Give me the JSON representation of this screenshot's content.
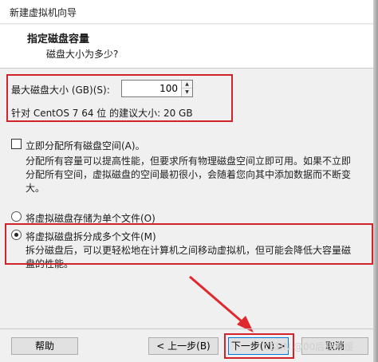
{
  "window": {
    "title": "新建虚拟机向导"
  },
  "header": {
    "title": "指定磁盘容量",
    "subtitle": "磁盘大小为多少?"
  },
  "disk": {
    "max_size_label": "最大磁盘大小 (GB)(S):",
    "max_size_value": "100",
    "recommend_text": "针对 CentOS 7 64 位 的建议大小: 20 GB"
  },
  "allocate": {
    "checkbox_label": "立即分配所有磁盘空间(A)。",
    "checked": false,
    "desc_line1": "分配所有容量可以提高性能，但要求所有物理磁盘空间立即可用。如果不立即",
    "desc_line2": "分配所有空间，虚拟磁盘的空间最初很小，会随着您向其中添加数据而不断变",
    "desc_line3": "大。"
  },
  "storage": {
    "single_label": "将虚拟磁盘存储为单个文件(O)",
    "split_label": "将虚拟磁盘拆分成多个文件(M)",
    "split_desc_line1": "拆分磁盘后，可以更轻松地在计算机之间移动虚拟机，但可能会降低大容量磁",
    "split_desc_line2": "盘的性能。",
    "selected": "split"
  },
  "buttons": {
    "help": "帮助",
    "back": "< 上一步(B)",
    "next": "下一步(N) >",
    "cancel": "取消"
  },
  "watermark": "CSDN @00后程序媛",
  "colors": {
    "highlight_red": "#d1232a",
    "arrow_red": "#e0282e"
  }
}
